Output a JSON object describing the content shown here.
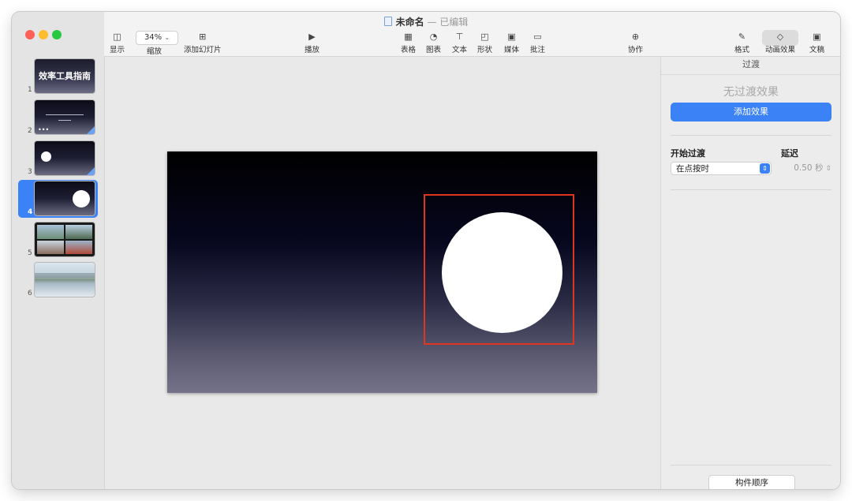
{
  "window": {
    "doc_title": "未命名",
    "separator": "—",
    "status": "已编辑"
  },
  "toolbar": {
    "view_label": "显示",
    "zoom_value": "34%",
    "zoom_label": "缩放",
    "add_slide_label": "添加幻灯片",
    "play_label": "播放",
    "table_label": "表格",
    "chart_label": "图表",
    "text_label": "文本",
    "shape_label": "形状",
    "media_label": "媒体",
    "comment_label": "批注",
    "collab_label": "协作",
    "format_label": "格式",
    "animate_label": "动画效果",
    "document_label": "文稿"
  },
  "slides": [
    {
      "number": "1",
      "title": "效率工具指南"
    },
    {
      "number": "2"
    },
    {
      "number": "3"
    },
    {
      "number": "4",
      "selected": true
    },
    {
      "number": "5"
    },
    {
      "number": "6"
    }
  ],
  "panel": {
    "header": "过渡",
    "no_effect": "无过渡效果",
    "add_effect_button": "添加效果",
    "start_transition_label": "开始过渡",
    "delay_label": "延迟",
    "start_value": "在点按时",
    "delay_value": "0.50 秒",
    "build_order_button": "构件顺序"
  },
  "colors": {
    "accent": "#3b82f6",
    "selection_border": "#e0351f"
  }
}
